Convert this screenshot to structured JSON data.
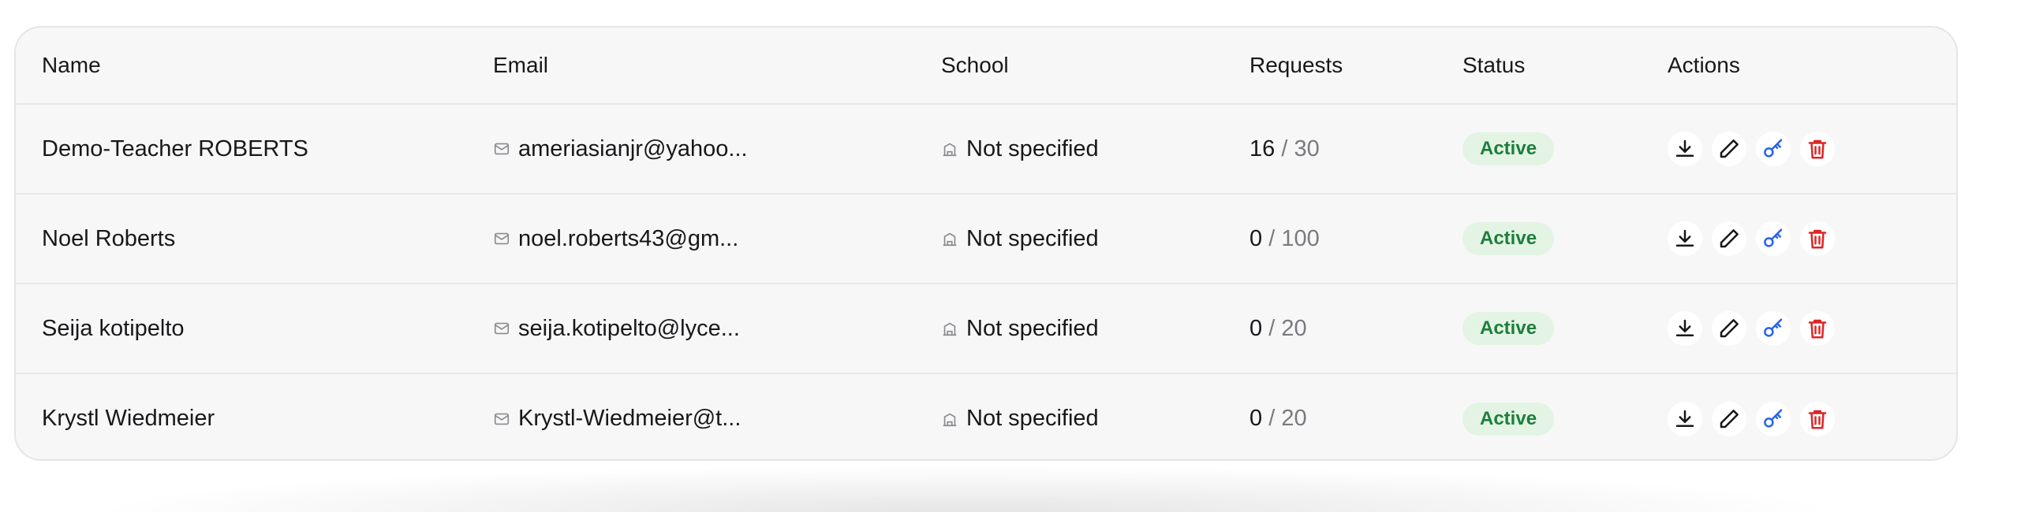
{
  "table": {
    "headers": {
      "name": "Name",
      "email": "Email",
      "school": "School",
      "requests": "Requests",
      "status": "Status",
      "actions": "Actions"
    },
    "rows": [
      {
        "name": "Demo-Teacher ROBERTS",
        "email": "ameriasianjr@yahoo...",
        "school": "Not specified",
        "requests_used": "16",
        "requests_separator": "/",
        "requests_limit": "30",
        "status": "Active"
      },
      {
        "name": "Noel Roberts",
        "email": "noel.roberts43@gm...",
        "school": "Not specified",
        "requests_used": "0",
        "requests_separator": "/",
        "requests_limit": "100",
        "status": "Active"
      },
      {
        "name": "Seija kotipelto",
        "email": "seija.kotipelto@lyce...",
        "school": "Not specified",
        "requests_used": "0",
        "requests_separator": "/",
        "requests_limit": "20",
        "status": "Active"
      },
      {
        "name": "Krystl Wiedmeier",
        "email": "Krystl-Wiedmeier@t...",
        "school": "Not specified",
        "requests_used": "0",
        "requests_separator": "/",
        "requests_limit": "20",
        "status": "Active"
      }
    ]
  },
  "icons": {
    "email": "mail-icon",
    "school": "school-building-icon",
    "actions": [
      "download-icon",
      "pencil-edit-icon",
      "key-icon",
      "trash-icon"
    ]
  },
  "colors": {
    "status_active_bg": "#e3f4e5",
    "status_active_text": "#1d7f3a",
    "key_icon": "#2563eb",
    "delete_icon": "#dc2626"
  }
}
